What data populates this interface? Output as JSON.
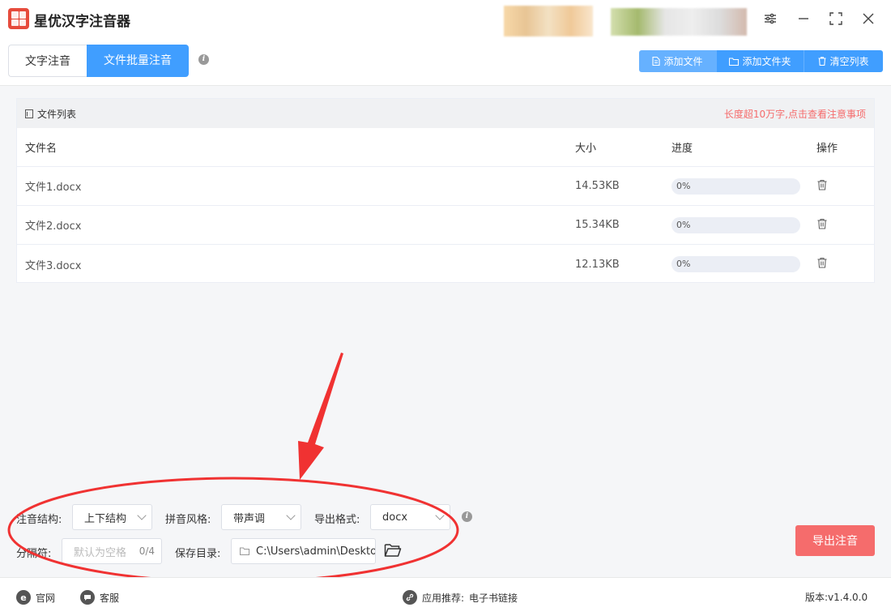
{
  "app": {
    "title": "星优汉字注音器"
  },
  "tabs": [
    {
      "label": "文字注音",
      "active": false
    },
    {
      "label": "文件批量注音",
      "active": true
    }
  ],
  "toolbar": {
    "add_file": "添加文件",
    "add_folder": "添加文件夹",
    "clear_list": "清空列表"
  },
  "file_list": {
    "title": "文件列表",
    "warning": "长度超10万字,点击查看注意事项",
    "columns": {
      "name": "文件名",
      "size": "大小",
      "progress": "进度",
      "action": "操作"
    },
    "rows": [
      {
        "name": "文件1.docx",
        "size": "14.53KB",
        "progress": "0%",
        "progress_value": 0
      },
      {
        "name": "文件2.docx",
        "size": "15.34KB",
        "progress": "0%",
        "progress_value": 0
      },
      {
        "name": "文件3.docx",
        "size": "12.13KB",
        "progress": "0%",
        "progress_value": 0
      }
    ]
  },
  "settings": {
    "structure_label": "注音结构:",
    "structure_value": "上下结构",
    "style_label": "拼音风格:",
    "style_value": "带声调",
    "format_label": "导出格式:",
    "format_value": "docx",
    "separator_label": "分隔符:",
    "separator_placeholder": "默认为空格",
    "separator_count": "0/4",
    "save_dir_label": "保存目录:",
    "save_dir_value": "C:\\Users\\admin\\Deskto"
  },
  "export_button": "导出注音",
  "footer": {
    "website": "官网",
    "service": "客服",
    "recommend_label": "应用推荐:",
    "recommend_value": "电子书链接",
    "version": "版本:v1.4.0.0"
  },
  "colors": {
    "primary": "#409eff",
    "danger": "#f56c6c",
    "annotation": "#f03232"
  }
}
